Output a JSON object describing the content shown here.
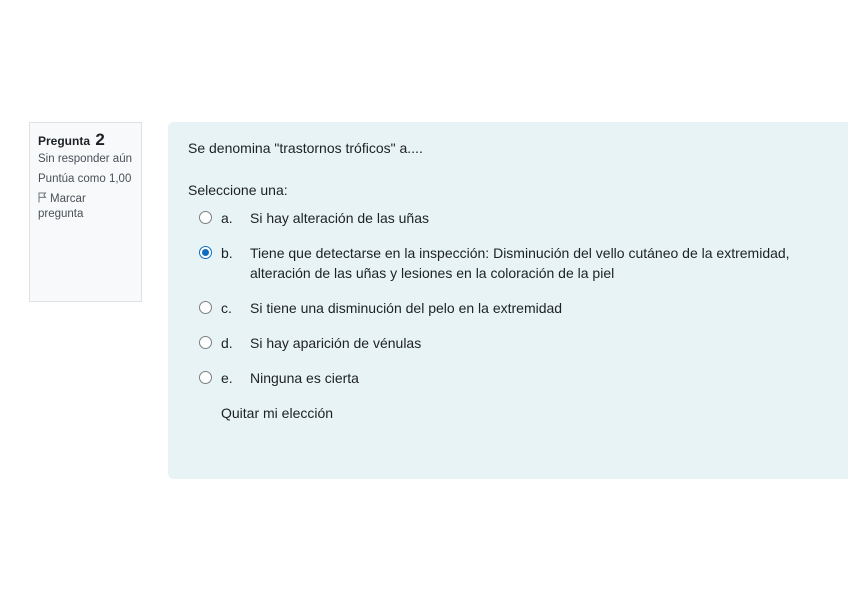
{
  "info": {
    "question_label": "Pregunta",
    "question_number": "2",
    "state": "Sin responder aún",
    "grade": "Puntúa como 1,00",
    "flag_label": "Marcar pregunta"
  },
  "question": {
    "text": "Se denomina \"trastornos tróficos\" a....",
    "prompt": "Seleccione una:",
    "answers": [
      {
        "letter": "a.",
        "text": "Si hay alteración de las uñas",
        "checked": false
      },
      {
        "letter": "b.",
        "text": "Tiene que detectarse en la inspección: Disminución del vello cutáneo de la extremidad, alteración de las uñas y lesiones en la coloración de la piel",
        "checked": true
      },
      {
        "letter": "c.",
        "text": "Si tiene una disminución del pelo en la extremidad",
        "checked": false
      },
      {
        "letter": "d.",
        "text": "Si hay aparición de vénulas",
        "checked": false
      },
      {
        "letter": "e.",
        "text": "Ninguna es cierta",
        "checked": false
      }
    ],
    "clear_label": "Quitar mi elección"
  },
  "colors": {
    "accent": "#0f6cbf",
    "content_bg": "#e7f3f5",
    "info_bg": "#f8f9fa"
  },
  "icons": {
    "flag": "flag-icon"
  }
}
